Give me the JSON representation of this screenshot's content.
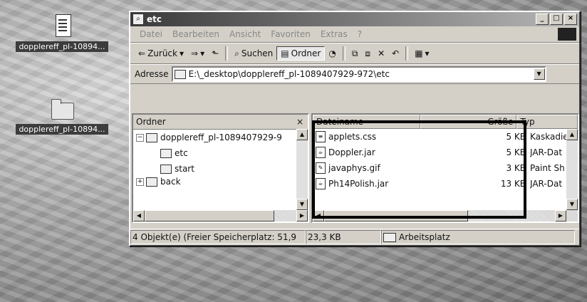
{
  "desktop": {
    "icons": [
      {
        "label": "dopplereff_pl-10894...",
        "icon": "document-icon"
      },
      {
        "label": "dopplereff_pl-10894...",
        "icon": "folder-icon"
      }
    ]
  },
  "window": {
    "title": "etc",
    "menu": [
      "Datei",
      "Bearbeiten",
      "Ansicht",
      "Favoriten",
      "Extras",
      "?"
    ],
    "toolbar": {
      "back": "Zurück",
      "search": "Suchen",
      "folders": "Ordner"
    },
    "address": {
      "label": "Adresse",
      "value": "E:\\_desktop\\dopplereff_pl-1089407929-972\\etc"
    },
    "tree": {
      "header": "Ordner",
      "close": "×",
      "items": [
        {
          "label": "dopplereff_pl-1089407929-9",
          "level": 0,
          "expander": "−"
        },
        {
          "label": "etc",
          "level": 1,
          "expander": ""
        },
        {
          "label": "start",
          "level": 1,
          "expander": ""
        },
        {
          "label": "back",
          "level": 0,
          "expander": "+"
        }
      ]
    },
    "list": {
      "columns": [
        "Dateiname",
        "Größe",
        "Typ"
      ],
      "files": [
        {
          "name": "applets.css",
          "size": "5 KB",
          "type": "Kaskadie"
        },
        {
          "name": "Doppler.jar",
          "size": "5 KB",
          "type": "JAR-Dat"
        },
        {
          "name": "javaphys.gif",
          "size": "3 KB",
          "type": "Paint Sh"
        },
        {
          "name": "Ph14Polish.jar",
          "size": "13 KB",
          "type": "JAR-Dat"
        }
      ]
    },
    "status": {
      "objects": "4 Objekt(e) (Freier Speicherplatz: 51,9",
      "size": "23,3 KB",
      "location": "Arbeitsplatz"
    }
  }
}
